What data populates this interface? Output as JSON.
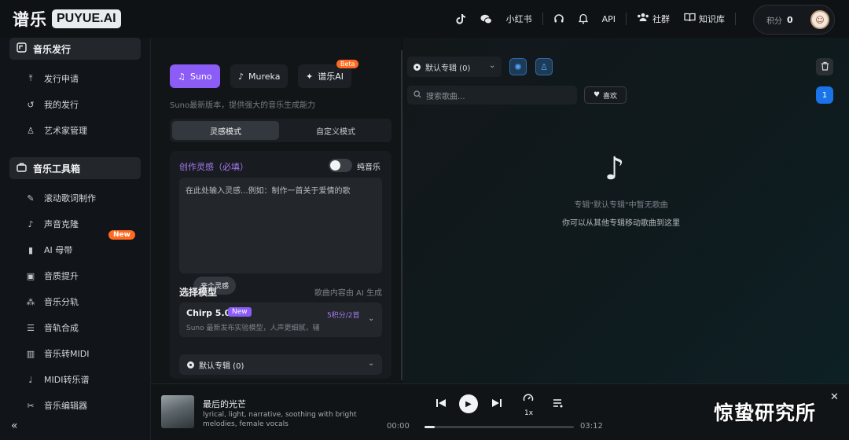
{
  "app": {
    "logo_cn": "谱乐",
    "logo_en": "PUYUE.AI"
  },
  "topbar": {
    "icons": [
      "tiktok-icon",
      "wechat-icon",
      "xiaohongshu-icon",
      "headset-icon",
      "bell-icon",
      "api-icon",
      "community-icon",
      "book-icon"
    ],
    "xiaohongshu_label": "小红书",
    "api_label": "API",
    "community_label": "社群",
    "knowledge_label": "知识库",
    "points_label": "积分",
    "points_value": "0"
  },
  "sidebar": {
    "section1_title": "音乐发行",
    "section1_items": [
      {
        "label": "发行申请",
        "icon": "upload-icon"
      },
      {
        "label": "我的发行",
        "icon": "history-icon"
      },
      {
        "label": "艺术家管理",
        "icon": "artist-icon"
      }
    ],
    "section2_title": "音乐工具箱",
    "section2_items": [
      {
        "label": "滚动歌词制作",
        "icon": "lyrics-icon"
      },
      {
        "label": "声音克隆",
        "icon": "voice-clone-icon"
      },
      {
        "label": "AI 母带",
        "icon": "mastering-icon"
      },
      {
        "label": "音质提升",
        "icon": "quality-icon"
      },
      {
        "label": "音乐分轨",
        "icon": "split-icon"
      },
      {
        "label": "音轨合成",
        "icon": "mixer-icon"
      },
      {
        "label": "音乐转MIDI",
        "icon": "piano-icon"
      },
      {
        "label": "MIDI转乐谱",
        "icon": "note-icon"
      },
      {
        "label": "音乐编辑器",
        "icon": "scissors-icon"
      }
    ],
    "new_badge": "New"
  },
  "creator": {
    "tabs": [
      {
        "label": "Suno",
        "active": true
      },
      {
        "label": "Mureka",
        "active": false
      },
      {
        "label": "谱乐AI",
        "active": false
      }
    ],
    "beta_badge": "Beta",
    "description": "Suno最新版本，提供强大的音乐生成能力",
    "modes": [
      "灵感模式",
      "自定义模式"
    ],
    "inspiration_title": "创作灵感（必填）",
    "pure_music_label": "纯音乐",
    "pure_music_on": false,
    "prompt_placeholder": "在此处输入灵感...例如：制作一首关于爱情的歌",
    "inspire_button": "来个灵感",
    "model_section_title": "选择模型",
    "model_section_hint": "歌曲内容由 AI 生成",
    "model_name": "Chirp 5.0",
    "model_new_badge": "New",
    "model_cost": "5积分/2首",
    "model_desc": "Suno 最新发布实验模型，人声更细腻，辅",
    "album_label": "默认专辑 (0)"
  },
  "library": {
    "album_select": "默认专辑 (0)",
    "search_placeholder": "搜索歌曲...",
    "like_label": "喜欢",
    "page_number": "1",
    "empty_title": "专辑\"默认专辑\"中暂无歌曲",
    "empty_hint": "你可以从其他专辑移动歌曲到这里"
  },
  "player": {
    "title": "最后的光芒",
    "tags": "lyrical, light, narrative, soothing with bright melodies, female vocals",
    "speed": "1x",
    "current_time": "00:00",
    "total_time": "03:12",
    "progress": 0.07
  },
  "watermark": "惊蛰研究所"
}
